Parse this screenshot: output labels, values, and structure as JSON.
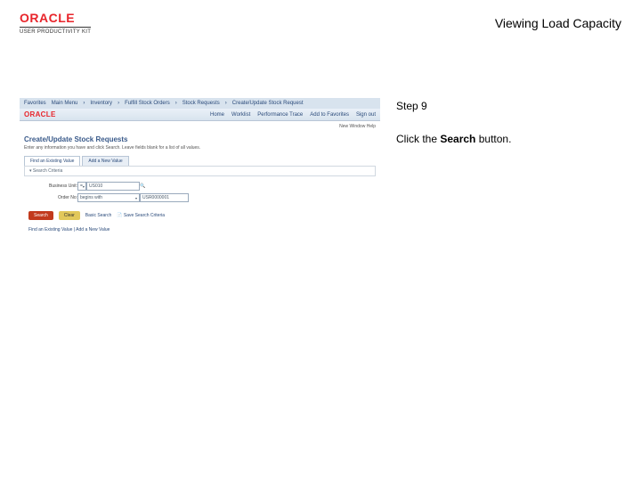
{
  "header": {
    "brand": "ORACLE",
    "subtitle": "USER PRODUCTIVITY KIT",
    "doc_title": "Viewing Load Capacity"
  },
  "instruction": {
    "step_label": "Step 9",
    "text_before": "Click the ",
    "bold_word": "Search",
    "text_after": " button."
  },
  "screenshot": {
    "breadcrumbs": [
      "Favorites",
      "Main Menu",
      "Inventory",
      "Fulfill Stock Orders",
      "Stock Requests",
      "Create/Update Stock Request"
    ],
    "app_brand": "ORACLE",
    "top_links": [
      "Home",
      "Worklist",
      "Performance Trace",
      "Add to Favorites",
      "Sign out"
    ],
    "status": "New Window   Help",
    "page_title": "Create/Update Stock Requests",
    "page_desc": "Enter any information you have and click Search. Leave fields blank for a list of all values.",
    "tabs": [
      "Find an Existing Value",
      "Add a New Value"
    ],
    "section_header": "▾ Search Criteria",
    "fields": {
      "business_unit_label": "Business Unit:",
      "business_unit_op": "=",
      "business_unit_value": "US010",
      "order_no_label": "Order No:",
      "order_no_op": "begins with",
      "order_no_value": "USR0000001"
    },
    "buttons": {
      "search": "Search",
      "clear": "Clear",
      "basic_search": "Basic Search",
      "save_criteria": "Save Search Criteria"
    },
    "bottom_tabs_line": "Find an Existing Value  |  Add a New Value"
  }
}
